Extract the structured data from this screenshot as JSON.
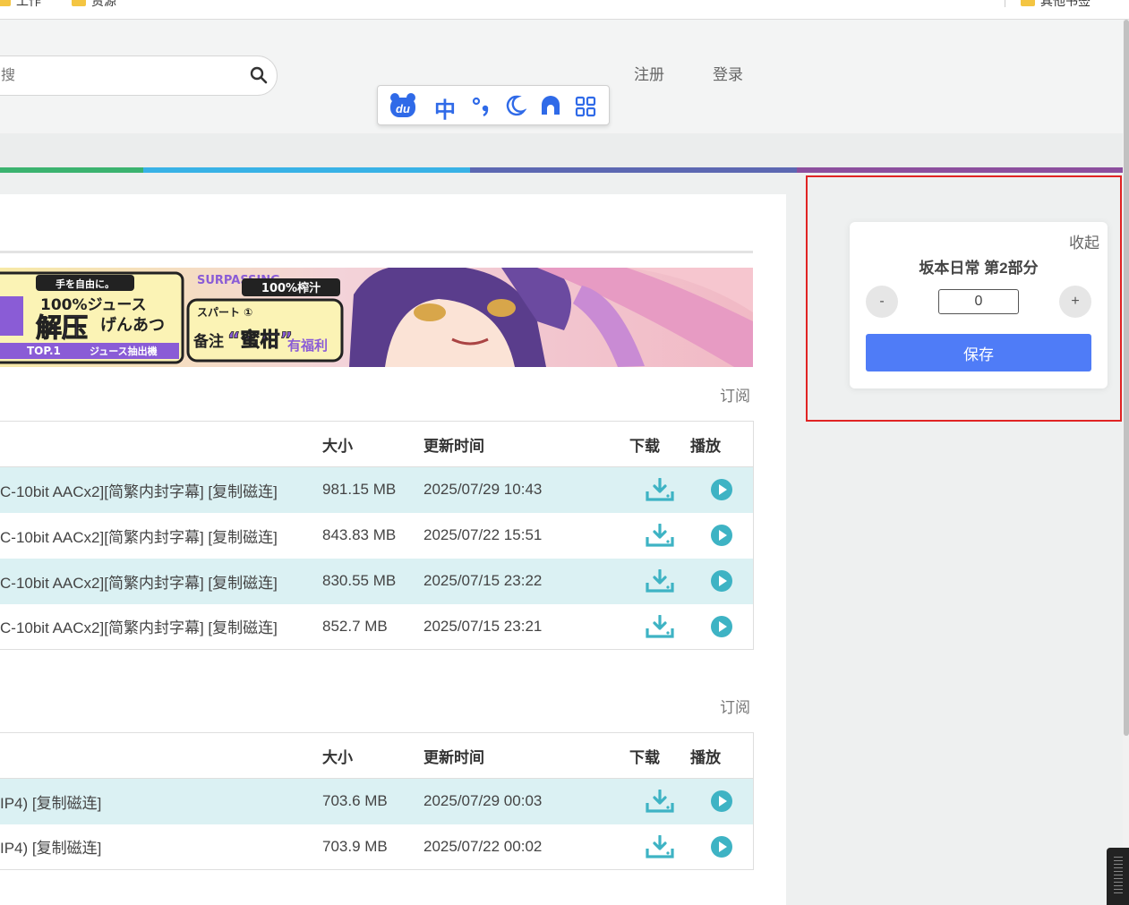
{
  "bookmarks": [
    {
      "label": "工作"
    },
    {
      "label": "资源"
    },
    {
      "label": "其他书签"
    }
  ],
  "header": {
    "search_placeholder": "搜",
    "register": "注册",
    "login": "登录"
  },
  "toolbar": {
    "lang_label": "中"
  },
  "colors": {
    "stripes": [
      "#3bb36f",
      "#38b2e6",
      "#5c68b2",
      "#8c4f9e"
    ],
    "accent": "#4f7cf7",
    "row_alt": "#dbf1f3",
    "icon_teal": "#3eb3c4"
  },
  "sections": [
    {
      "subscribe": "订阅",
      "columns": {
        "name": "",
        "size": "大小",
        "time": "更新时间",
        "download": "下载",
        "play": "播放"
      },
      "rows": [
        {
          "name": "C-10bit AACx2][简繁内封字幕] [复制磁连]",
          "size": "981.15 MB",
          "time": "2025/07/29 10:43"
        },
        {
          "name": "C-10bit AACx2][简繁内封字幕] [复制磁连]",
          "size": "843.83 MB",
          "time": "2025/07/22 15:51"
        },
        {
          "name": "C-10bit AACx2][简繁内封字幕] [复制磁连]",
          "size": "830.55 MB",
          "time": "2025/07/15 23:22"
        },
        {
          "name": "C-10bit AACx2][简繁内封字幕] [复制磁连]",
          "size": "852.7 MB",
          "time": "2025/07/15 23:21"
        }
      ]
    },
    {
      "subscribe": "订阅",
      "columns": {
        "name": "",
        "size": "大小",
        "time": "更新时间",
        "download": "下载",
        "play": "播放"
      },
      "rows": [
        {
          "name": "IP4) [复制磁连]",
          "size": "703.6 MB",
          "time": "2025/07/29 00:03"
        },
        {
          "name": "IP4) [复制磁连]",
          "size": "703.9 MB",
          "time": "2025/07/22 00:02"
        }
      ]
    }
  ],
  "panel": {
    "collapse": "收起",
    "title": "坂本日常 第2部分",
    "minus": "-",
    "plus": "+",
    "value": "0",
    "save": "保存"
  },
  "banner": {
    "line1": "手を自由に。",
    "line2": "100%ジュース",
    "line3": "解压",
    "line4": "げんあつ",
    "line5": "TOP.1",
    "line6": "ジュース抽出機",
    "line7": "SURPASSING",
    "line8": "100%榨汁",
    "line9": "スパート ①",
    "line10": "备注",
    "line11": "“蜜柑”",
    "line12": "有福利"
  }
}
